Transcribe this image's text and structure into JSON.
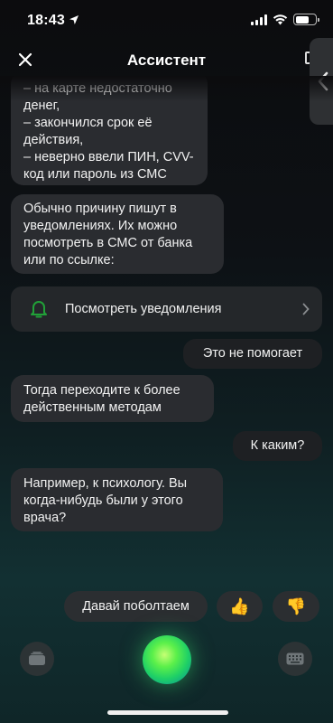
{
  "status_bar": {
    "time": "18:43"
  },
  "nav": {
    "title": "Ассистент"
  },
  "messages": [
    {
      "from": "assistant",
      "text": "– на карте недостаточно\nденег,\n– закончился срок её\nдействия,\n– неверно ввели ПИН, CVV-\nкод или пароль из СМС"
    },
    {
      "from": "assistant",
      "text": "Обычно причину пишут в\nуведомлениях. Их можно\nпосмотреть в СМС от банка\nили по ссылке:"
    },
    {
      "from": "user",
      "text": "Это не помогает"
    },
    {
      "from": "assistant",
      "text": "Тогда переходите к более\nдейственным методам"
    },
    {
      "from": "user",
      "text": "К каким?"
    },
    {
      "from": "assistant",
      "text": "Например, к психологу. Вы\nкогда-нибудь были у этого\nврача?"
    }
  ],
  "notifications_card": {
    "label": "Посмотреть уведомления",
    "icon": "bell-icon"
  },
  "quick_replies": {
    "chat_label": "Давай поболтаем",
    "like_emoji": "👍",
    "dislike_emoji": "👎"
  },
  "colors": {
    "accent_green": "#21a038",
    "bubble": "#2a2c30",
    "background": "#0d1115"
  }
}
